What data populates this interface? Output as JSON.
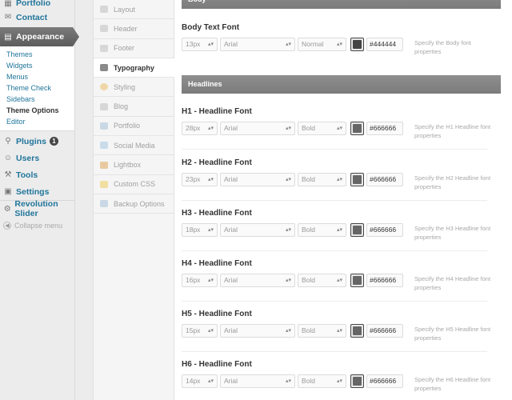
{
  "wp_menu": {
    "portfolio": "Portfolio",
    "contact": "Contact",
    "appearance": "Appearance",
    "appearance_sub": [
      "Themes",
      "Widgets",
      "Menus",
      "Theme Check",
      "Sidebars",
      "Theme Options",
      "Editor"
    ],
    "plugins": "Plugins",
    "plugins_badge": "1",
    "users": "Users",
    "tools": "Tools",
    "settings": "Settings",
    "revolution": "Revolution Slider",
    "collapse": "Collapse menu"
  },
  "options_nav": [
    "Layout",
    "Header",
    "Footer",
    "Typography",
    "Styling",
    "Blog",
    "Portfolio",
    "Social Media",
    "Lightbox",
    "Custom CSS",
    "Backup Options"
  ],
  "sections": {
    "body": "Body",
    "headlines": "Headlines"
  },
  "fonts": [
    {
      "title": "Body Text Font",
      "size": "13px",
      "family": "Arial",
      "weight": "Normal",
      "color": "#444444",
      "desc": "Specify the Body font properties"
    },
    {
      "title": "H1 - Headline Font",
      "size": "28px",
      "family": "Arial",
      "weight": "Bold",
      "color": "#666666",
      "desc": "Specify the H1 Headline font properties"
    },
    {
      "title": "H2 - Headline Font",
      "size": "23px",
      "family": "Arial",
      "weight": "Bold",
      "color": "#666666",
      "desc": "Specify the H2 Headline font properties"
    },
    {
      "title": "H3 - Headline Font",
      "size": "18px",
      "family": "Arial",
      "weight": "Bold",
      "color": "#666666",
      "desc": "Specify the H3 Headline font properties"
    },
    {
      "title": "H4 - Headline Font",
      "size": "16px",
      "family": "Arial",
      "weight": "Bold",
      "color": "#666666",
      "desc": "Specify the H4 Headline font properties"
    },
    {
      "title": "H5 - Headline Font",
      "size": "15px",
      "family": "Arial",
      "weight": "Bold",
      "color": "#666666",
      "desc": "Specify the H5 Headline font properties"
    },
    {
      "title": "H6 - Headline Font",
      "size": "14px",
      "family": "Arial",
      "weight": "Bold",
      "color": "#666666",
      "desc": "Specify the H6 Headline font properties"
    }
  ]
}
